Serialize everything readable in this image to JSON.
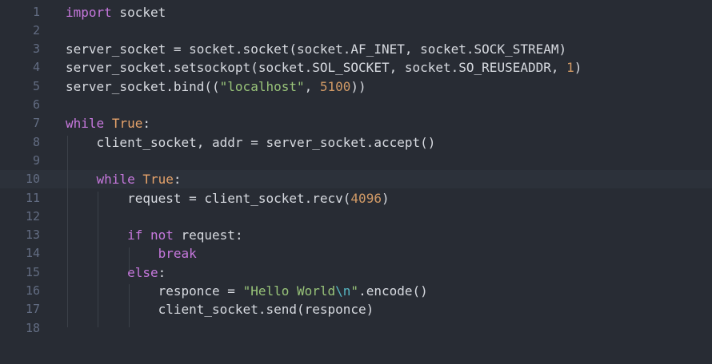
{
  "editor": {
    "line_numbers": [
      "1",
      "2",
      "3",
      "4",
      "5",
      "6",
      "7",
      "8",
      "9",
      "10",
      "11",
      "12",
      "13",
      "14",
      "15",
      "16",
      "17",
      "18"
    ],
    "lines": [
      [
        {
          "t": "kw",
          "v": "import"
        },
        {
          "t": "txt",
          "v": " socket"
        }
      ],
      [],
      [
        {
          "t": "txt",
          "v": "server_socket = socket.socket(socket.AF_INET, socket.SOCK_STREAM)"
        }
      ],
      [
        {
          "t": "txt",
          "v": "server_socket.setsockopt(socket.SOL_SOCKET, socket.SO_REUSEADDR, "
        },
        {
          "t": "num",
          "v": "1"
        },
        {
          "t": "txt",
          "v": ")"
        }
      ],
      [
        {
          "t": "txt",
          "v": "server_socket.bind(("
        },
        {
          "t": "str",
          "v": "\"localhost\""
        },
        {
          "t": "txt",
          "v": ", "
        },
        {
          "t": "num",
          "v": "5100"
        },
        {
          "t": "txt",
          "v": "))"
        }
      ],
      [],
      [
        {
          "t": "kw",
          "v": "while"
        },
        {
          "t": "txt",
          "v": " "
        },
        {
          "t": "bool",
          "v": "True"
        },
        {
          "t": "txt",
          "v": ":"
        }
      ],
      [
        {
          "t": "txt",
          "v": "    client_socket, addr = server_socket.accept()"
        }
      ],
      [],
      [
        {
          "t": "txt",
          "v": "    "
        },
        {
          "t": "kw",
          "v": "while"
        },
        {
          "t": "txt",
          "v": " "
        },
        {
          "t": "bool",
          "v": "True"
        },
        {
          "t": "txt",
          "v": ":"
        }
      ],
      [
        {
          "t": "txt",
          "v": "        request = client_socket.recv("
        },
        {
          "t": "num",
          "v": "4096"
        },
        {
          "t": "txt",
          "v": ")"
        }
      ],
      [],
      [
        {
          "t": "txt",
          "v": "        "
        },
        {
          "t": "kw",
          "v": "if"
        },
        {
          "t": "txt",
          "v": " "
        },
        {
          "t": "kw",
          "v": "not"
        },
        {
          "t": "txt",
          "v": " request:"
        }
      ],
      [
        {
          "t": "txt",
          "v": "            "
        },
        {
          "t": "kw",
          "v": "break"
        }
      ],
      [
        {
          "t": "txt",
          "v": "        "
        },
        {
          "t": "kw",
          "v": "else"
        },
        {
          "t": "txt",
          "v": ":"
        }
      ],
      [
        {
          "t": "txt",
          "v": "            responce = "
        },
        {
          "t": "str",
          "v": "\"Hello World"
        },
        {
          "t": "esc",
          "v": "\\n"
        },
        {
          "t": "str",
          "v": "\""
        },
        {
          "t": "txt",
          "v": ".encode()"
        }
      ],
      [
        {
          "t": "txt",
          "v": "            client_socket.send(responce)"
        }
      ],
      []
    ],
    "active_line": 10,
    "colors": {
      "background": "#282c34",
      "keyword": "#c678dd",
      "boolean": "#e5a26a",
      "number": "#d19a66",
      "string": "#98c379",
      "escape": "#56b6c2",
      "text": "#d7dae0",
      "gutter": "#636d83"
    }
  }
}
